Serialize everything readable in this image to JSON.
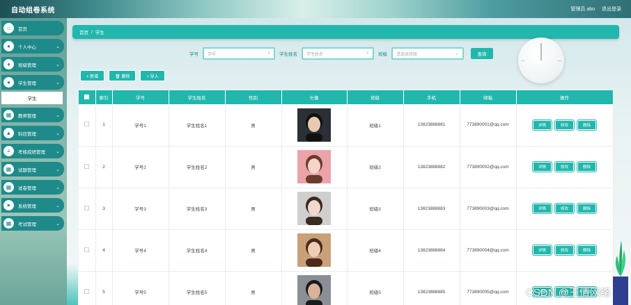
{
  "app": {
    "title": "自动组卷系统"
  },
  "topbar": {
    "admin": "管理员 abo",
    "logout": "退出登录"
  },
  "sidebar": {
    "items": [
      {
        "label": "首页",
        "icon": "home-icon",
        "glyph": "⌂"
      },
      {
        "label": "个人中心",
        "icon": "user-icon",
        "glyph": "●",
        "chev": "⌄"
      },
      {
        "label": "班级管理",
        "icon": "shield-icon",
        "glyph": "♦",
        "chev": "⌄"
      },
      {
        "label": "学生管理",
        "icon": "user-icon",
        "glyph": "●",
        "chev": "⌄",
        "sub": "学生"
      },
      {
        "label": "教师管理",
        "icon": "grid-icon",
        "glyph": "▦",
        "chev": "⌄"
      },
      {
        "label": "科目管理",
        "icon": "bank-icon",
        "glyph": "▲",
        "chev": "⌄"
      },
      {
        "label": "考核成绩管理",
        "icon": "list-icon",
        "glyph": "≡",
        "chev": "⌄"
      },
      {
        "label": "试题管理",
        "icon": "grid-icon",
        "glyph": "▦",
        "chev": "⌄"
      },
      {
        "label": "试卷管理",
        "icon": "grid-icon",
        "glyph": "▦",
        "chev": "⌄"
      },
      {
        "label": "系统管理",
        "icon": "send-icon",
        "glyph": "➤",
        "chev": "⌄"
      },
      {
        "label": "考试管理",
        "icon": "grid-icon",
        "glyph": "▦",
        "chev": "⌄"
      }
    ]
  },
  "breadcrumb": {
    "home": "首页",
    "sep": "/",
    "current": "学生"
  },
  "search": {
    "xuehao_label": "学号",
    "xuehao_placeholder": "学号",
    "name_label": "学生姓名",
    "name_placeholder": "学生姓名",
    "class_label": "班级",
    "class_placeholder": "请选择班级",
    "search_icon": "⌕",
    "select_icon": "⌄",
    "button": "查询"
  },
  "actions": {
    "add": "+ 新增",
    "delete": "🗑 删除",
    "import": "+ 导入"
  },
  "table": {
    "headers": [
      "",
      "索引",
      "学号",
      "学生姓名",
      "性别",
      "头像",
      "班级",
      "手机",
      "邮箱",
      "操作"
    ],
    "rows": [
      {
        "index": "1",
        "id": "学号1",
        "name": "学生姓名1",
        "gender": "男",
        "class": "班级1",
        "phone": "13823888881",
        "email": "773890001@qq.com"
      },
      {
        "index": "2",
        "id": "学号2",
        "name": "学生姓名2",
        "gender": "男",
        "class": "班级2",
        "phone": "13823888882",
        "email": "773890002@qq.com"
      },
      {
        "index": "3",
        "id": "学号3",
        "name": "学生姓名3",
        "gender": "男",
        "class": "班级3",
        "phone": "13823888883",
        "email": "773890003@qq.com"
      },
      {
        "index": "4",
        "id": "学号4",
        "name": "学生姓名4",
        "gender": "男",
        "class": "班级4",
        "phone": "13823888884",
        "email": "773890004@qq.com"
      },
      {
        "index": "5",
        "id": "学号5",
        "name": "学生姓名5",
        "gender": "男",
        "class": "班级5",
        "phone": "13823888885",
        "email": "773890005@qq.com"
      }
    ],
    "ops": {
      "detail": "详情",
      "edit": "修改",
      "delete": "删除"
    }
  },
  "watermark": "CSDN @王倩网络",
  "colors": {
    "accent": "#22b7ad",
    "sidebar_item": "#1f8a8a"
  }
}
